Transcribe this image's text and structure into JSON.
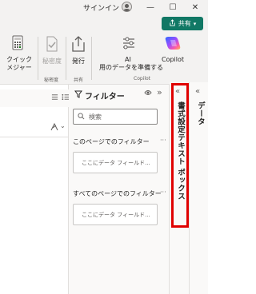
{
  "titlebar": {
    "signin_label": "サインイン",
    "minimize": "—",
    "maximize": "☐",
    "close": "✕"
  },
  "ribbon": {
    "share_label": "共有",
    "quick_measure_1": "クイック",
    "quick_measure_2": "メジャー",
    "sensitivity_label": "秘密度",
    "sensitivity_group": "秘密度",
    "publish_label": "発行",
    "share_group": "共有",
    "ai_label_1": "AI",
    "ai_label_2": "用のデータを準備する",
    "copilot_label": "Copilot",
    "copilot_group": "Copilot"
  },
  "filter_pane": {
    "title": "フィルター",
    "search_placeholder": "検索",
    "this_page_label": "このページでのフィルター",
    "this_page_more": "···",
    "drop_box_1": "ここにデータ フィールド...",
    "all_pages_label": "すべてのページでのフィルター",
    "all_pages_more": "···",
    "drop_box_2": "ここにデータ フィールド..."
  },
  "format_pane": {
    "title": "書式設定テキスト ボックス"
  },
  "data_pane": {
    "title": "データ"
  },
  "colors": {
    "accent": "#117865",
    "highlight_border": "#e00000",
    "copilot_gradient": [
      "#2f6bff",
      "#9b4dff",
      "#ff5aa8",
      "#ffb74a"
    ]
  }
}
